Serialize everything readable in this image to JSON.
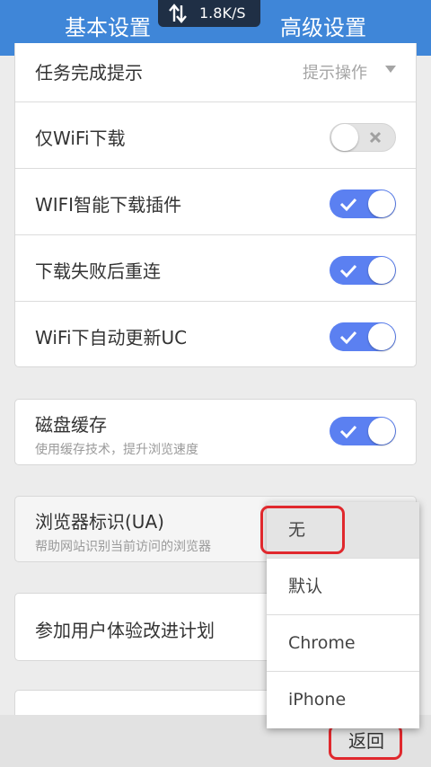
{
  "status": {
    "speed": "1.8K/S"
  },
  "tabs": [
    {
      "label": "基本设置",
      "active": false
    },
    {
      "label": "高级设置",
      "active": true
    }
  ],
  "settings": {
    "task_complete": {
      "label": "任务完成提示",
      "value": "提示操作"
    },
    "wifi_only": {
      "label": "仅WiFi下载",
      "on": false
    },
    "wifi_smart_plugin": {
      "label": "WIFI智能下载插件",
      "on": true
    },
    "retry_on_fail": {
      "label": "下载失败后重连",
      "on": true
    },
    "wifi_auto_update": {
      "label": "WiFi下自动更新UC",
      "on": true
    },
    "disk_cache": {
      "label": "磁盘缓存",
      "sub": "使用缓存技术，提升浏览速度",
      "on": true
    },
    "ua": {
      "label": "浏览器标识(UA)",
      "sub": "帮助网站识别当前访问的浏览器"
    },
    "ux_plan": {
      "label": "参加用户体验改进计划"
    }
  },
  "ua_dropdown": {
    "options": [
      "无",
      "默认",
      "Chrome",
      "iPhone"
    ],
    "selected": "无"
  },
  "footer": {
    "back_label": "返回"
  },
  "colors": {
    "accent": "#3f86d8",
    "toggle_on": "#5b80f1",
    "highlight": "#e0282d"
  }
}
